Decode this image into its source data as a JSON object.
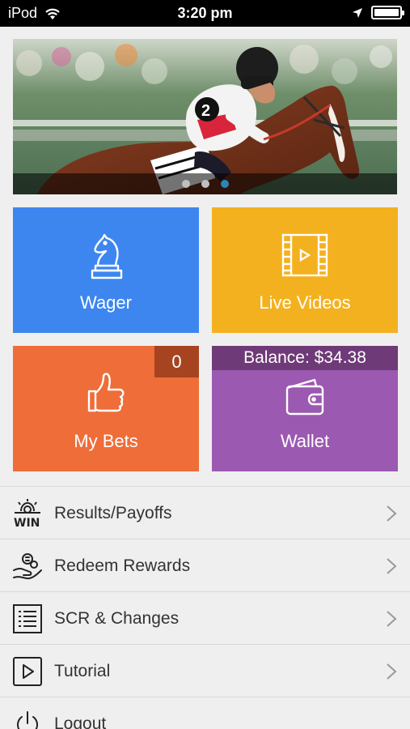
{
  "status_bar": {
    "carrier": "iPod",
    "time": "3:20 pm"
  },
  "hero": {
    "slide_count": 3,
    "active_slide": 3,
    "colors": {
      "active_dot": "#2a86b8",
      "inactive_dot": "#bfbfbf"
    }
  },
  "tiles": {
    "wager": {
      "label": "Wager",
      "color": "#3d86f0",
      "icon": "chess-knight-icon"
    },
    "live_videos": {
      "label": "Live Videos",
      "color": "#f4b11f",
      "icon": "film-play-icon"
    },
    "my_bets": {
      "label": "My Bets",
      "badge": "0",
      "color": "#ee6d39",
      "icon": "thumbs-up-icon"
    },
    "wallet": {
      "label": "Wallet",
      "balance": "Balance: $34.38",
      "color": "#9c59b1",
      "icon": "wallet-icon"
    }
  },
  "menu": {
    "items": [
      {
        "label": "Results/Payoffs",
        "icon": "win-icon"
      },
      {
        "label": "Redeem Rewards",
        "icon": "redeem-hand-icon"
      },
      {
        "label": "SCR & Changes",
        "icon": "list-icon"
      },
      {
        "label": "Tutorial",
        "icon": "play-square-icon"
      },
      {
        "label": "Logout",
        "icon": "power-icon"
      }
    ]
  }
}
